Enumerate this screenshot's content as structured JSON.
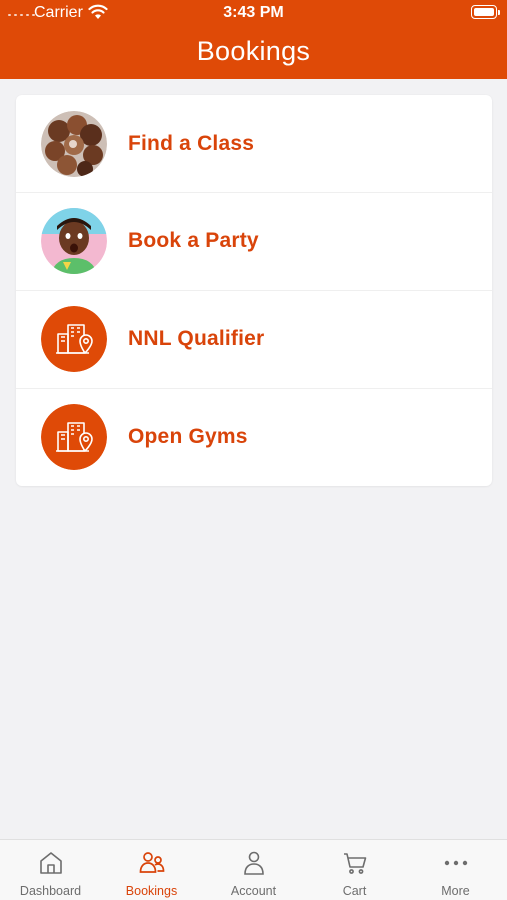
{
  "status_bar": {
    "carrier": "Carrier",
    "time": "3:43 PM"
  },
  "header": {
    "title": "Bookings"
  },
  "menu": {
    "items": [
      {
        "label": "Find a Class",
        "icon": "group-photo-thumbnail"
      },
      {
        "label": "Book a Party",
        "icon": "child-photo-thumbnail"
      },
      {
        "label": "NNL Qualifier",
        "icon": "gym-location-icon"
      },
      {
        "label": "Open Gyms",
        "icon": "gym-location-icon"
      }
    ]
  },
  "tabbar": {
    "tabs": [
      {
        "label": "Dashboard",
        "icon": "home-icon"
      },
      {
        "label": "Bookings",
        "icon": "people-icon",
        "active": true
      },
      {
        "label": "Account",
        "icon": "person-icon"
      },
      {
        "label": "Cart",
        "icon": "cart-icon"
      },
      {
        "label": "More",
        "icon": "more-dots-icon"
      }
    ]
  },
  "colors": {
    "brand": "#df4a07",
    "accent_text": "#d9440a",
    "background": "#f2f2f4"
  }
}
